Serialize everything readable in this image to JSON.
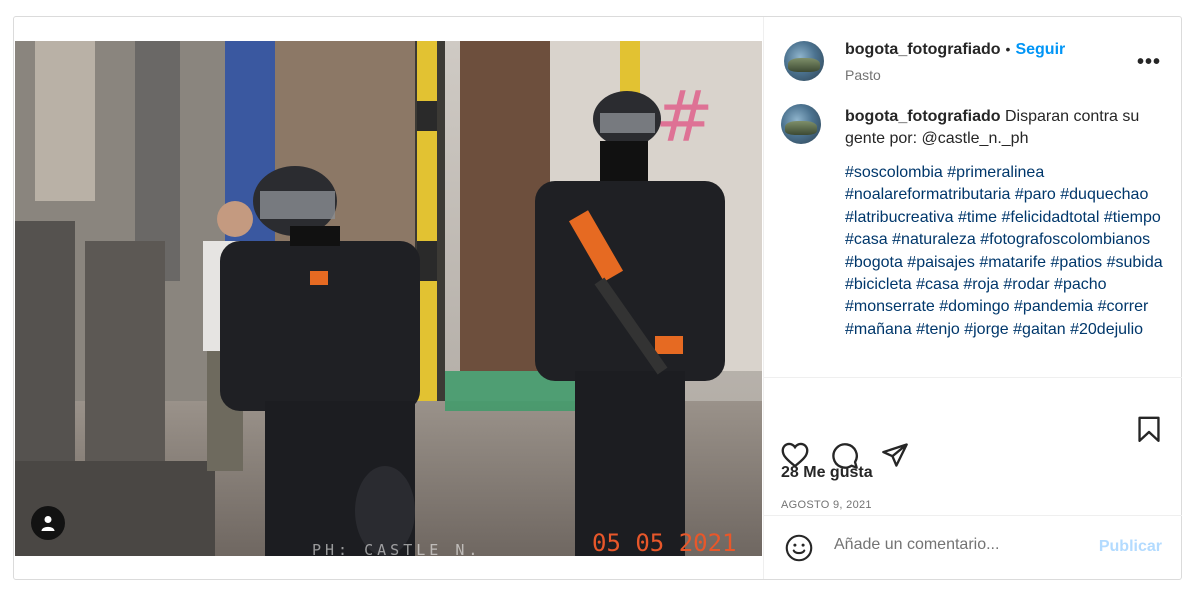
{
  "post": {
    "media": {
      "watermark": "PH: CASTLE N.",
      "date_stamp": "05 05 2021",
      "tag_icon": "user-tag-icon"
    },
    "header": {
      "username": "bogota_fotografiado",
      "dot": "•",
      "follow_label": "Seguir",
      "location": "Pasto",
      "more_icon": "more-options-icon",
      "more_glyph": "•••"
    },
    "caption": {
      "username": "bogota_fotografiado",
      "text": " Disparan contra su gente por: @castle_n._ph",
      "hashtags": [
        "#soscolombia",
        "#primeralinea",
        "#noalareformatributaria",
        "#paro",
        "#duquechao",
        "#latribucreativa",
        "#time",
        "#felicidadtotal",
        "#tiempo",
        "#casa",
        "#naturaleza",
        "#fotografoscolombianos",
        "#bogota",
        "#paisajes",
        "#matarife",
        "#patios",
        "#subida",
        "#bicicleta",
        "#casa",
        "#roja",
        "#rodar",
        "#pacho",
        "#monserrate",
        "#domingo",
        "#pandemia",
        "#correr",
        "#mañana",
        "#tenjo",
        "#jorge",
        "#gaitan",
        "#20dejulio"
      ]
    },
    "actions": {
      "like_icon": "heart-icon",
      "comment_icon": "comment-icon",
      "share_icon": "share-icon",
      "save_icon": "bookmark-icon",
      "likes_text": "28 Me gusta",
      "date_text": "AGOSTO 9, 2021"
    },
    "comment_box": {
      "emoji_icon": "emoji-icon",
      "placeholder": "Añade un comentario...",
      "publish_label": "Publicar"
    },
    "colors": {
      "link_blue": "#0095f6",
      "hashtag": "#00376b",
      "publish_disabled": "#b3dbff",
      "date_stamp": "#e8572a"
    }
  }
}
